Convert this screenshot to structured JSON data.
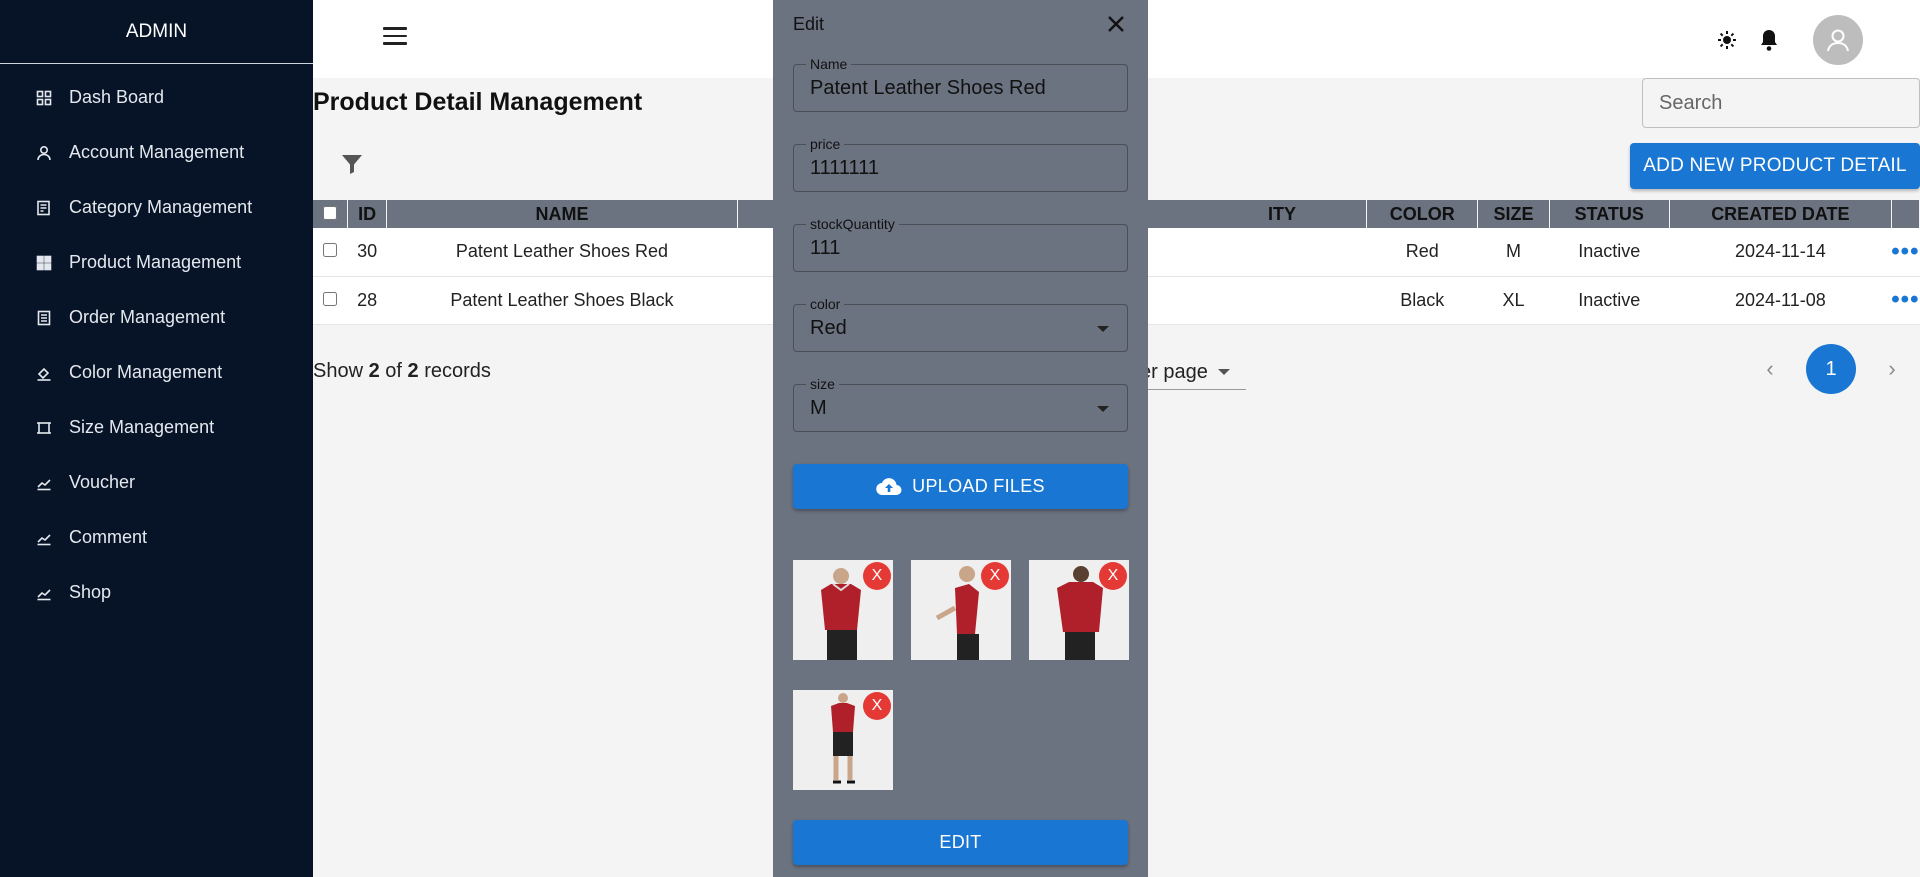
{
  "sidebar": {
    "brand": "ADMIN",
    "items": [
      {
        "label": "Dash Board",
        "icon": "dashboard-icon"
      },
      {
        "label": "Account Management",
        "icon": "user-icon"
      },
      {
        "label": "Category Management",
        "icon": "category-icon"
      },
      {
        "label": "Product Management",
        "icon": "product-icon"
      },
      {
        "label": "Order Management",
        "icon": "order-icon"
      },
      {
        "label": "Color Management",
        "icon": "color-fill-icon"
      },
      {
        "label": "Size Management",
        "icon": "size-icon"
      },
      {
        "label": "Voucher",
        "icon": "chart-line-icon"
      },
      {
        "label": "Comment",
        "icon": "chart-line-icon"
      },
      {
        "label": "Shop",
        "icon": "chart-line-icon"
      }
    ]
  },
  "header": {
    "title": "Product Detail Management",
    "search_placeholder": "Search",
    "add_label": "ADD NEW PRODUCT DETAIL"
  },
  "table": {
    "columns": [
      "ID",
      "NAME",
      "ITY",
      "COLOR",
      "SIZE",
      "STATUS",
      "CREATED DATE"
    ],
    "rows": [
      {
        "id": "30",
        "name": "Patent Leather Shoes Red",
        "color": "Red",
        "size": "M",
        "status": "Inactive",
        "created": "2024-11-14"
      },
      {
        "id": "28",
        "name": "Patent Leather Shoes Black",
        "color": "Black",
        "size": "XL",
        "status": "Inactive",
        "created": "2024-11-08"
      }
    ]
  },
  "footer": {
    "show": "Show",
    "shown": "2",
    "of": "of",
    "total": "2",
    "records": "records",
    "rows_per_page_label": "er page",
    "current_page": "1"
  },
  "drawer": {
    "title": "Edit",
    "fields": {
      "name": {
        "label": "Name",
        "value": "Patent Leather Shoes Red"
      },
      "price": {
        "label": "price",
        "value": "1111111"
      },
      "stock": {
        "label": "stockQuantity",
        "value": "111"
      },
      "color": {
        "label": "color",
        "value": "Red"
      },
      "size": {
        "label": "size",
        "value": "M"
      }
    },
    "upload_label": "UPLOAD FILES",
    "remove_label": "X",
    "edit_label": "EDIT"
  },
  "colors": {
    "sidebar_bg": "#071427",
    "accent": "#1976d2",
    "drawer_bg": "#6b7280",
    "remove_red": "#e53935",
    "shirt_red": "#b0202a"
  }
}
